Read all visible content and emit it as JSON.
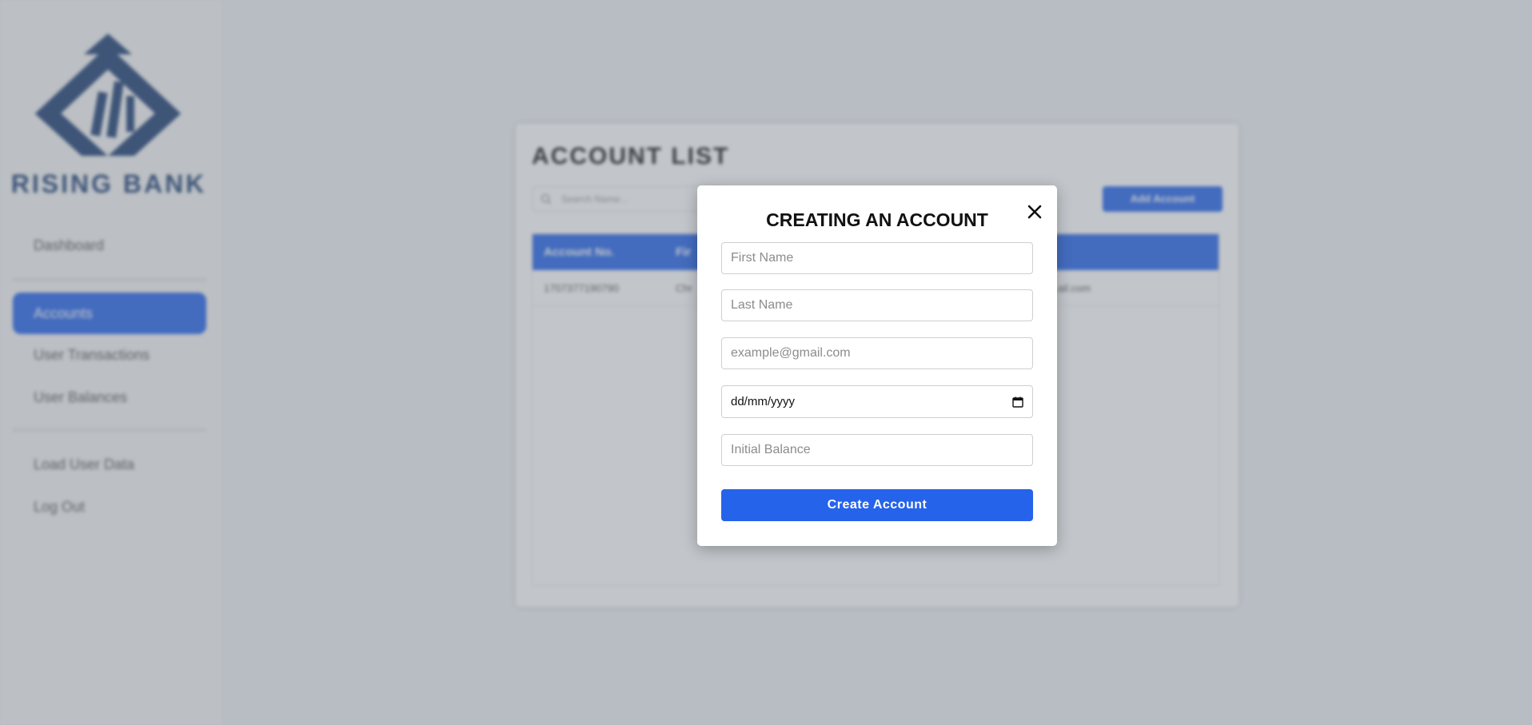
{
  "sidebar": {
    "brand": "RISING BANK",
    "items": [
      {
        "label": "Dashboard"
      },
      {
        "label": "Accounts",
        "active": true
      },
      {
        "label": "User Transactions"
      },
      {
        "label": "User Balances"
      },
      {
        "label": "Load User Data"
      },
      {
        "label": "Log Out"
      }
    ]
  },
  "account_list": {
    "title": "ACCOUNT LIST",
    "search_placeholder": "Search Name...",
    "add_button": "Add Account",
    "columns": [
      "Account No.",
      "Fir"
    ],
    "rows": [
      {
        "account_no": "1707377190790",
        "first_name": "Chr",
        "email": "...ail.com"
      }
    ]
  },
  "modal": {
    "title": "CREATING AN ACCOUNT",
    "close_icon": "close-icon",
    "first_name_placeholder": "First Name",
    "last_name_placeholder": "Last Name",
    "email_placeholder": "example@gmail.com",
    "dob_placeholder": "dd/mm/yyyy",
    "balance_placeholder": "Initial Balance",
    "submit_label": "Create Account"
  },
  "colors": {
    "accent": "#2563eb",
    "brand": "#1d3d73"
  }
}
